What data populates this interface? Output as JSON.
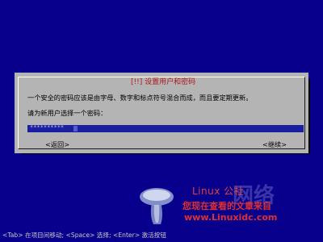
{
  "dialog": {
    "title": "[!!] 设置用户和密码",
    "description": "一个安全的密码应该是由字母、数字和标点符号混合而成，而且要定期更新。",
    "prompt": "请为新用户选择一个密码：",
    "password_value": "**********",
    "back_button": "<返回>",
    "continue_button": "<继续>"
  },
  "help_bar": "<Tab> 在项目间移动; <Space> 选择; <Enter> 激活按钮",
  "watermark": {
    "title": "Linux 公社",
    "subtitle": "您现在查看的文章来自",
    "url": "www.Linuxidc.com",
    "background_text": "网络"
  },
  "colors": {
    "screen_bg": "#08008c",
    "dialog_bg": "#b4b4b4",
    "title_red": "#b01818",
    "input_bg": "#1a1fa0"
  }
}
